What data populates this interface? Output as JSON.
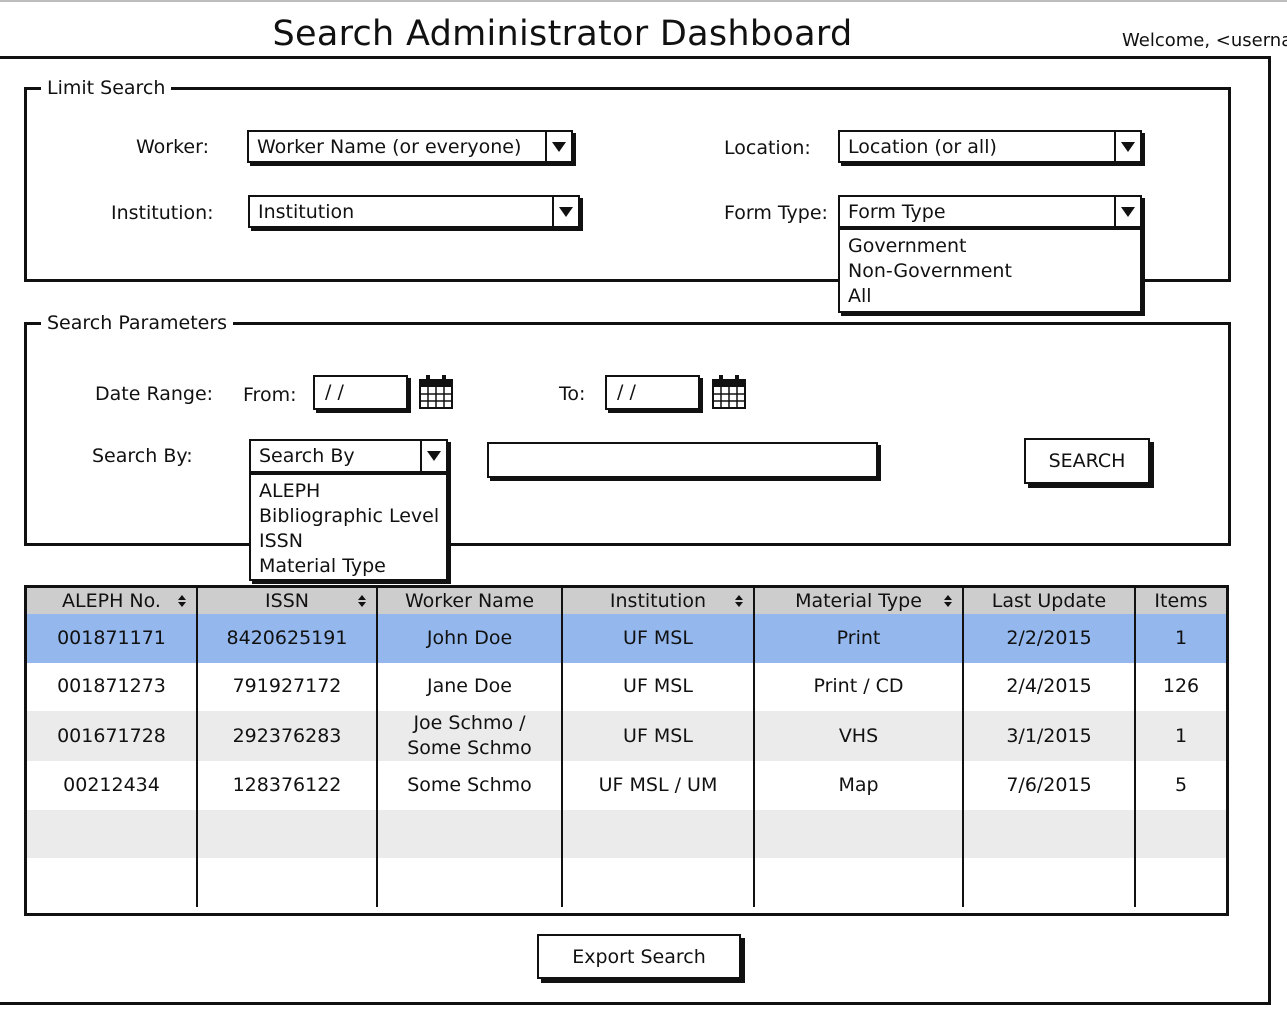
{
  "header": {
    "title": "Search Administrator Dashboard",
    "welcome": "Welcome, <userna"
  },
  "limit_search": {
    "legend": "Limit Search",
    "worker": {
      "label": "Worker:",
      "value": "Worker Name (or everyone)"
    },
    "institution": {
      "label": "Institution:",
      "value": "Institution"
    },
    "location": {
      "label": "Location:",
      "value": "Location (or all)"
    },
    "form_type": {
      "label": "Form Type:",
      "value": "Form Type",
      "options": [
        "Government",
        "Non-Government",
        "All"
      ]
    }
  },
  "search_parameters": {
    "legend": "Search Parameters",
    "date_range_label": "Date Range:",
    "from_label": "From:",
    "from_value": "/ /",
    "to_label": "To:",
    "to_value": "/ /",
    "search_by": {
      "label": "Search By:",
      "value": "Search By",
      "options": [
        "ALEPH",
        "Bibliographic Level",
        "ISSN",
        "Material Type"
      ]
    },
    "search_text_value": "",
    "search_button": "SEARCH"
  },
  "results": {
    "columns": [
      {
        "label": "ALEPH No.",
        "sortable": true
      },
      {
        "label": "ISSN",
        "sortable": true
      },
      {
        "label": "Worker Name",
        "sortable": false
      },
      {
        "label": "Institution",
        "sortable": true
      },
      {
        "label": "Material Type",
        "sortable": true
      },
      {
        "label": "Last Update",
        "sortable": false
      },
      {
        "label": "Items",
        "sortable": false
      }
    ],
    "rows": [
      [
        "001871171",
        "8420625191",
        "John Doe",
        "UF MSL",
        "Print",
        "2/2/2015",
        "1"
      ],
      [
        "001871273",
        "791927172",
        "Jane Doe",
        "UF MSL",
        "Print / CD",
        "2/4/2015",
        "126"
      ],
      [
        "001671728",
        "292376283",
        "Joe Schmo / Some Schmo",
        "UF MSL",
        "VHS",
        "3/1/2015",
        "1"
      ],
      [
        "00212434",
        "128376122",
        "Some Schmo",
        "UF MSL / UM",
        "Map",
        "7/6/2015",
        "5"
      ]
    ],
    "selected_row": 0,
    "empty_rows": 2
  },
  "footer": {
    "export_button": "Export Search"
  },
  "colors": {
    "selected_row": "#94b8ee",
    "header_bg": "#cdcdcd",
    "alt_row": "#ebebeb",
    "border": "#111111"
  },
  "icons": {
    "dropdown_arrow": "chevron-down-icon",
    "calendar": "calendar-icon",
    "sort": "sort-icon"
  }
}
